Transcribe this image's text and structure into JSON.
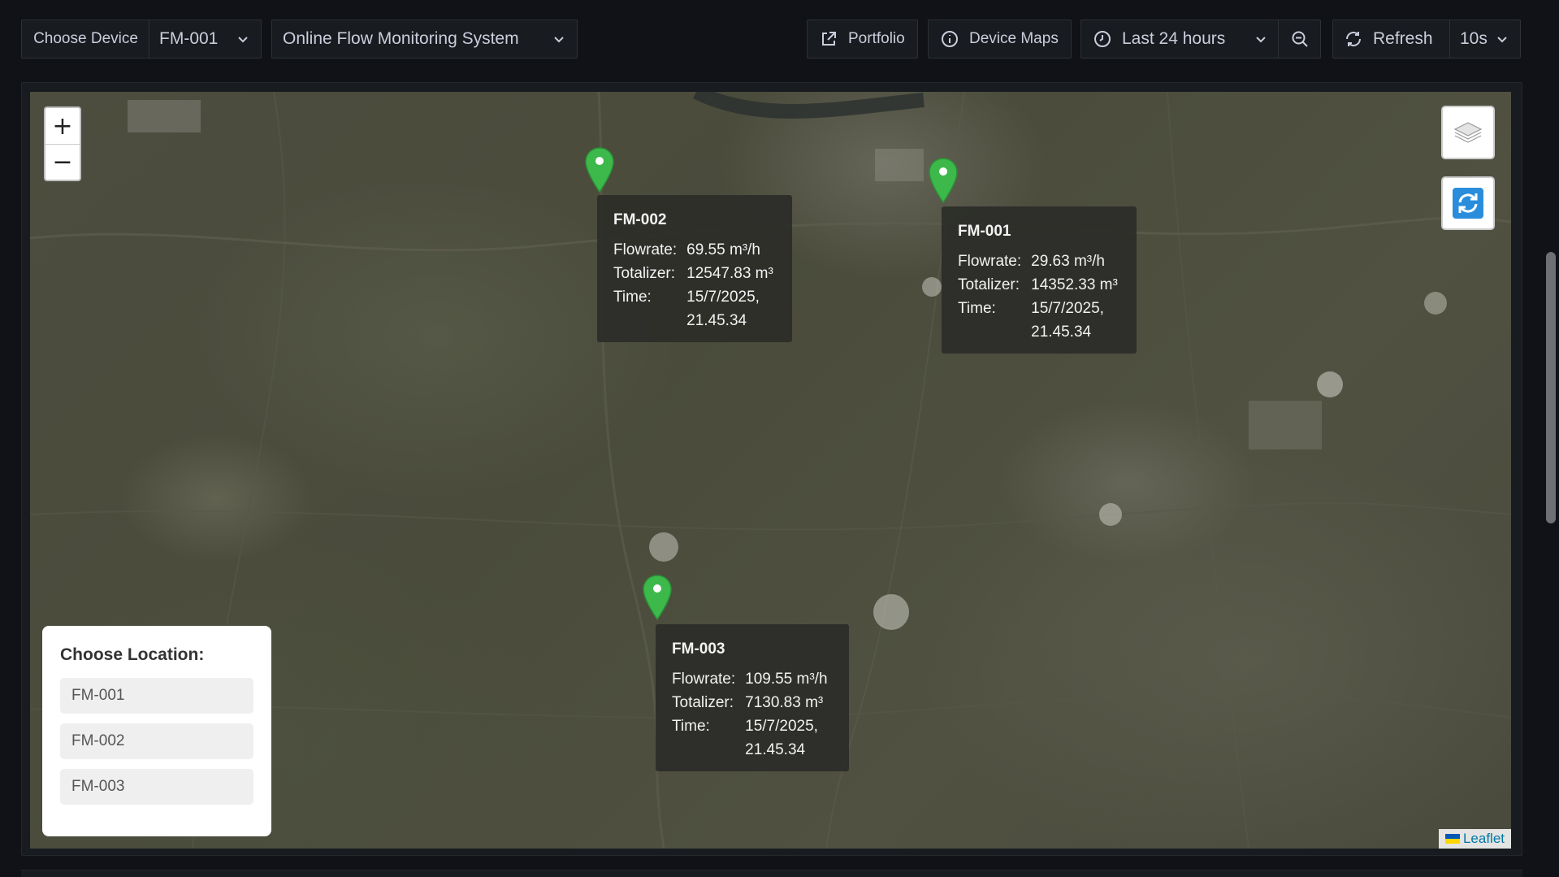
{
  "toolbar": {
    "variable_label": "Choose Device",
    "variable_value": "FM-001",
    "dashboard_title": "Online Flow Monitoring System",
    "portfolio_label": "Portfolio",
    "device_maps_label": "Device Maps",
    "time_range": "Last 24 hours",
    "refresh_label": "Refresh",
    "refresh_interval": "10s"
  },
  "map": {
    "zoom_in": "+",
    "zoom_out": "−",
    "attribution": "Leaflet",
    "markers": [
      {
        "name": "FM-002",
        "flow_label": "Flowrate:",
        "flowrate": "69.55 m³/h",
        "tot_label": "Totalizer:",
        "totalizer": "12547.83 m³",
        "time_label": "Time:",
        "time": "15/7/2025,\n21.45.34"
      },
      {
        "name": "FM-001",
        "flow_label": "Flowrate:",
        "flowrate": "29.63 m³/h",
        "tot_label": "Totalizer:",
        "totalizer": "14352.33 m³",
        "time_label": "Time:",
        "time": "15/7/2025,\n21.45.34"
      },
      {
        "name": "FM-003",
        "flow_label": "Flowrate:",
        "flowrate": "109.55 m³/h",
        "tot_label": "Totalizer:",
        "totalizer": "7130.83 m³",
        "time_label": "Time:",
        "time": "15/7/2025,\n21.45.34"
      }
    ],
    "location_chooser": {
      "title": "Choose Location:",
      "items": [
        "FM-001",
        "FM-002",
        "FM-003"
      ]
    }
  },
  "colors": {
    "marker": "#3cb94a",
    "background": "#111217",
    "panel": "#181b1f"
  }
}
